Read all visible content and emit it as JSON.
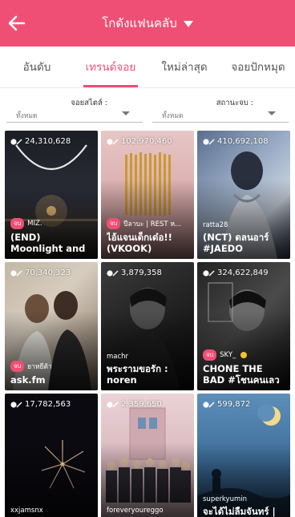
{
  "header": {
    "title": "โกดังแฟนคลับ",
    "back_icon": "arrow-left-icon",
    "background": "#ef4f74"
  },
  "tabs": [
    {
      "label": "อันดับ",
      "active": false
    },
    {
      "label": "เทรนด์จอย",
      "active": true
    },
    {
      "label": "ใหม่ล่าสุด",
      "active": false
    },
    {
      "label": "จอยปักหมุด",
      "active": false
    }
  ],
  "filters": [
    {
      "label": "จอยสไตล์ :",
      "value": "ทั้งหมด"
    },
    {
      "label": "สถานะจบ :",
      "value": "ทั้งหมด"
    }
  ],
  "cards": [
    {
      "views": "24,310,628",
      "badge": "จบ",
      "author": "MIZ.",
      "title": "(END) Moonlight and Sunshine (k..."
    },
    {
      "views": "102,970,460",
      "badge": "จบ",
      "author": "ปีลาบะ | REST ห...",
      "title": "ไอ้แจนเด็กเด๋อ!! (VKOOK)"
    },
    {
      "views": "410,692,108",
      "badge": "",
      "author": "ratta28",
      "title": "(NCT) ดลนอาร์ #JAEDO"
    },
    {
      "views": "70,340,323",
      "badge": "จบ",
      "author": "ยาหยีต้า",
      "title": "ask.fm"
    },
    {
      "views": "3,879,358",
      "badge": "",
      "author": "machr",
      "title": "พระรามขอรัก : noren"
    },
    {
      "views": "324,622,849",
      "badge": "จบ",
      "author": "SKY_",
      "title": "CHONE THE BAD #โชนคนเลวบน"
    },
    {
      "views": "17,782,563",
      "badge": "",
      "author": "xxjamsnx",
      "title": ""
    },
    {
      "views": "2,359,650",
      "badge": "",
      "author": "foreveryoureggo",
      "title": ""
    },
    {
      "views": "599,872",
      "badge": "",
      "author": "superkyumin",
      "title": "จะได้ไม่ลืมจันทร์ |"
    }
  ]
}
